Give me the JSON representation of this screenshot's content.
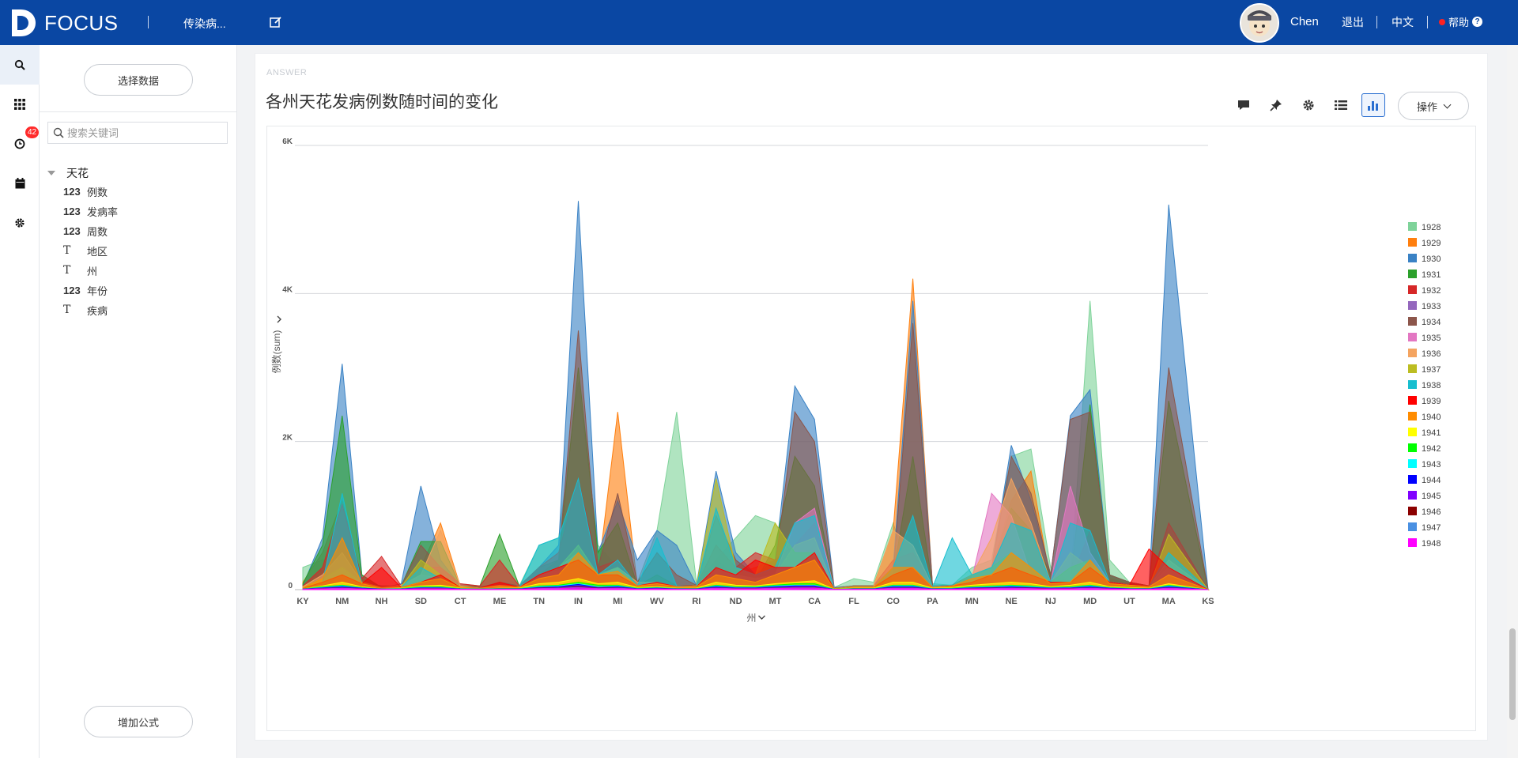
{
  "app": {
    "brand": "FOCUS",
    "nav_title": "传染病...",
    "user": "Chen",
    "logout": "退出",
    "lang": "中文",
    "help": "帮助"
  },
  "rail": {
    "history_badge": "42",
    "icons": [
      "search-icon",
      "grid-icon",
      "history-icon",
      "calendar-icon",
      "settings-icon"
    ]
  },
  "datapanel": {
    "select_data": "选择数据",
    "search_placeholder": "搜索关键词",
    "table": "天花",
    "fields": [
      {
        "type": "123",
        "name": "例数"
      },
      {
        "type": "123",
        "name": "发病率"
      },
      {
        "type": "123",
        "name": "周数"
      },
      {
        "type": "T",
        "name": "地区"
      },
      {
        "type": "T",
        "name": "州"
      },
      {
        "type": "123",
        "name": "年份"
      },
      {
        "type": "T",
        "name": "疾病"
      }
    ],
    "add_formula": "增加公式"
  },
  "card": {
    "tag": "ANSWER",
    "title": "各州天花发病例数随时间的变化",
    "operate": "操作"
  },
  "chart_data": {
    "type": "area",
    "title": "",
    "xlabel": "州",
    "ylabel": "例数(sum)",
    "ylim": [
      0,
      6000
    ],
    "yticks": [
      {
        "v": 0,
        "label": "0"
      },
      {
        "v": 2000,
        "label": "2K"
      },
      {
        "v": 4000,
        "label": "4K"
      },
      {
        "v": 6000,
        "label": "6K"
      }
    ],
    "categories": [
      "KY",
      "",
      "NM",
      "",
      "NH",
      "",
      "SD",
      "",
      "CT",
      "",
      "ME",
      "",
      "TN",
      "",
      "IN",
      "",
      "MI",
      "",
      "WV",
      "",
      "RI",
      "",
      "ND",
      "",
      "MT",
      "",
      "CA",
      "",
      "FL",
      "",
      "CO",
      "",
      "PA",
      "",
      "MN",
      "",
      "NE",
      "",
      "NJ",
      "",
      "MD",
      "",
      "UT",
      "",
      "MA",
      "",
      "KS"
    ],
    "grid": true,
    "legend_position": "right",
    "series": [
      {
        "name": "1928",
        "color": "#7fd39a",
        "values": [
          300,
          400,
          200,
          100,
          50,
          30,
          200,
          100,
          80,
          50,
          30,
          50,
          600,
          700,
          2800,
          600,
          300,
          100,
          800,
          2400,
          100,
          400,
          700,
          1000,
          900,
          400,
          600,
          30,
          150,
          100,
          900,
          50,
          80,
          60,
          300,
          400,
          1800,
          1900,
          300,
          100,
          3900,
          400,
          100,
          50,
          300
        ]
      },
      {
        "name": "1929",
        "color": "#ff7f0e",
        "values": [
          100,
          500,
          1200,
          150,
          30,
          50,
          300,
          900,
          50,
          20,
          30,
          50,
          200,
          300,
          400,
          200,
          2400,
          50,
          100,
          50,
          60,
          400,
          200,
          300,
          400,
          350,
          500,
          20,
          50,
          50,
          800,
          4200,
          50,
          60,
          200,
          300,
          1200,
          1600,
          100,
          50,
          400,
          150,
          80,
          50,
          700
        ]
      },
      {
        "name": "1930",
        "color": "#3a82c5",
        "values": [
          50,
          700,
          3050,
          200,
          20,
          80,
          1400,
          400,
          50,
          20,
          30,
          40,
          300,
          600,
          5250,
          500,
          1200,
          400,
          800,
          600,
          60,
          1600,
          500,
          200,
          400,
          2750,
          2300,
          30,
          50,
          50,
          300,
          3900,
          50,
          60,
          200,
          300,
          1950,
          1200,
          200,
          2350,
          2700,
          200,
          100,
          50,
          5200
        ]
      },
      {
        "name": "1931",
        "color": "#2ca02c",
        "values": [
          80,
          600,
          2350,
          200,
          30,
          50,
          650,
          650,
          50,
          50,
          750,
          50,
          200,
          400,
          3000,
          500,
          900,
          50,
          200,
          50,
          60,
          200,
          300,
          100,
          600,
          1800,
          1400,
          20,
          50,
          50,
          200,
          1800,
          50,
          60,
          100,
          300,
          1100,
          800,
          200,
          100,
          2500,
          200,
          100,
          50,
          2550
        ]
      },
      {
        "name": "1932",
        "color": "#d62728",
        "values": [
          50,
          300,
          1150,
          150,
          450,
          50,
          300,
          300,
          80,
          50,
          400,
          50,
          300,
          500,
          1500,
          300,
          400,
          50,
          100,
          50,
          60,
          600,
          300,
          500,
          400,
          600,
          900,
          20,
          50,
          50,
          400,
          500,
          50,
          60,
          200,
          300,
          400,
          300,
          100,
          100,
          800,
          100,
          80,
          50,
          900
        ]
      },
      {
        "name": "1934",
        "color": "#8c564b",
        "values": [
          40,
          200,
          400,
          100,
          50,
          50,
          600,
          300,
          50,
          30,
          100,
          50,
          300,
          400,
          3500,
          300,
          1300,
          100,
          500,
          200,
          60,
          1000,
          400,
          200,
          300,
          2400,
          2000,
          20,
          50,
          50,
          200,
          3600,
          50,
          60,
          200,
          300,
          1800,
          1300,
          200,
          2300,
          2400,
          200,
          100,
          50,
          3000
        ]
      },
      {
        "name": "1935",
        "color": "#e377c2",
        "values": [
          30,
          150,
          300,
          100,
          30,
          40,
          200,
          150,
          40,
          20,
          50,
          40,
          200,
          250,
          400,
          200,
          300,
          50,
          100,
          40,
          50,
          300,
          200,
          150,
          200,
          900,
          1100,
          15,
          40,
          40,
          100,
          300,
          40,
          50,
          150,
          1300,
          1000,
          200,
          100,
          1400,
          500,
          100,
          60,
          40,
          300
        ]
      },
      {
        "name": "1936",
        "color": "#f4a460",
        "values": [
          40,
          200,
          500,
          100,
          30,
          60,
          200,
          800,
          50,
          20,
          60,
          40,
          150,
          300,
          500,
          200,
          300,
          100,
          100,
          40,
          50,
          300,
          200,
          150,
          200,
          600,
          700,
          15,
          40,
          40,
          800,
          600,
          40,
          50,
          200,
          700,
          1500,
          900,
          100,
          500,
          300,
          100,
          60,
          40,
          400
        ]
      },
      {
        "name": "1937",
        "color": "#bcbd22",
        "values": [
          30,
          150,
          300,
          100,
          30,
          40,
          400,
          200,
          40,
          20,
          50,
          40,
          200,
          300,
          600,
          200,
          300,
          50,
          100,
          40,
          50,
          1500,
          300,
          200,
          900,
          500,
          500,
          15,
          40,
          40,
          200,
          300,
          40,
          50,
          200,
          300,
          500,
          300,
          100,
          300,
          400,
          100,
          60,
          40,
          750
        ]
      },
      {
        "name": "1938",
        "color": "#17becf",
        "values": [
          20,
          100,
          1300,
          80,
          20,
          30,
          300,
          150,
          30,
          20,
          40,
          30,
          600,
          700,
          1500,
          200,
          400,
          50,
          700,
          50,
          40,
          1100,
          300,
          200,
          300,
          900,
          1000,
          10,
          30,
          30,
          300,
          1000,
          30,
          700,
          200,
          300,
          900,
          800,
          100,
          900,
          800,
          100,
          60,
          40,
          500
        ]
      },
      {
        "name": "1939",
        "color": "#ff0000",
        "values": [
          20,
          100,
          200,
          80,
          300,
          30,
          100,
          200,
          30,
          20,
          100,
          30,
          200,
          300,
          400,
          200,
          200,
          50,
          100,
          40,
          40,
          300,
          200,
          400,
          300,
          300,
          500,
          10,
          30,
          30,
          200,
          300,
          30,
          50,
          100,
          200,
          300,
          200,
          100,
          100,
          300,
          100,
          60,
          550,
          300
        ]
      },
      {
        "name": "1940",
        "color": "#ff8c00",
        "values": [
          20,
          150,
          700,
          80,
          20,
          30,
          100,
          150,
          30,
          20,
          50,
          30,
          150,
          200,
          500,
          200,
          250,
          50,
          80,
          40,
          40,
          200,
          150,
          100,
          200,
          300,
          400,
          10,
          30,
          30,
          300,
          300,
          30,
          50,
          150,
          200,
          500,
          300,
          80,
          100,
          400,
          80,
          60,
          40,
          200
        ]
      },
      {
        "name": "1941",
        "color": "#ffff00",
        "values": [
          10,
          50,
          100,
          40,
          10,
          20,
          50,
          60,
          20,
          10,
          20,
          20,
          80,
          100,
          150,
          80,
          100,
          30,
          40,
          20,
          20,
          100,
          60,
          50,
          80,
          100,
          120,
          5,
          20,
          20,
          100,
          100,
          20,
          30,
          60,
          80,
          100,
          80,
          40,
          60,
          100,
          40,
          30,
          20,
          80
        ]
      },
      {
        "name": "1942",
        "color": "#00ff00",
        "values": [
          10,
          40,
          60,
          30,
          10,
          15,
          40,
          40,
          15,
          10,
          15,
          15,
          50,
          60,
          100,
          60,
          60,
          20,
          30,
          15,
          15,
          60,
          40,
          40,
          60,
          80,
          80,
          5,
          15,
          15,
          60,
          60,
          15,
          20,
          40,
          50,
          60,
          50,
          30,
          40,
          60,
          30,
          20,
          15,
          60
        ]
      },
      {
        "name": "1943",
        "color": "#00ffff",
        "values": [
          10,
          30,
          50,
          25,
          10,
          12,
          30,
          30,
          12,
          8,
          12,
          12,
          40,
          50,
          80,
          40,
          50,
          15,
          25,
          12,
          12,
          50,
          30,
          30,
          50,
          60,
          60,
          4,
          12,
          12,
          50,
          50,
          12,
          15,
          30,
          40,
          50,
          40,
          25,
          30,
          50,
          25,
          15,
          12,
          50
        ]
      },
      {
        "name": "1944",
        "color": "#0000ff",
        "values": [
          8,
          25,
          40,
          20,
          8,
          10,
          25,
          25,
          10,
          6,
          10,
          10,
          30,
          40,
          70,
          30,
          40,
          12,
          20,
          10,
          10,
          40,
          25,
          25,
          40,
          50,
          50,
          3,
          10,
          10,
          40,
          40,
          10,
          12,
          25,
          30,
          40,
          30,
          20,
          25,
          40,
          20,
          12,
          10,
          40
        ]
      },
      {
        "name": "1945",
        "color": "#8000ff",
        "values": [
          6,
          20,
          30,
          15,
          6,
          8,
          20,
          20,
          8,
          5,
          8,
          8,
          25,
          30,
          50,
          25,
          30,
          10,
          15,
          8,
          8,
          30,
          20,
          20,
          30,
          40,
          40,
          3,
          8,
          8,
          30,
          30,
          8,
          10,
          20,
          25,
          30,
          25,
          15,
          20,
          30,
          15,
          10,
          8,
          30
        ]
      },
      {
        "name": "1946",
        "color": "#8b0000",
        "values": [
          5,
          15,
          25,
          12,
          5,
          6,
          15,
          15,
          6,
          4,
          6,
          6,
          20,
          25,
          40,
          20,
          25,
          8,
          12,
          6,
          6,
          25,
          15,
          15,
          25,
          30,
          30,
          2,
          6,
          6,
          25,
          25,
          6,
          8,
          15,
          20,
          25,
          20,
          12,
          15,
          25,
          12,
          8,
          6,
          25
        ]
      },
      {
        "name": "1947",
        "color": "#4a90e2",
        "values": [
          4,
          12,
          20,
          10,
          4,
          5,
          12,
          12,
          5,
          3,
          5,
          5,
          15,
          20,
          30,
          15,
          20,
          6,
          10,
          5,
          5,
          20,
          12,
          12,
          20,
          25,
          25,
          2,
          5,
          5,
          20,
          20,
          5,
          6,
          12,
          15,
          20,
          15,
          10,
          12,
          20,
          10,
          6,
          5,
          20
        ]
      },
      {
        "name": "1948",
        "color": "#ff00ff",
        "values": [
          3,
          10,
          15,
          8,
          3,
          4,
          10,
          10,
          4,
          2,
          4,
          4,
          12,
          15,
          25,
          12,
          15,
          5,
          8,
          4,
          4,
          15,
          10,
          10,
          15,
          20,
          20,
          1,
          4,
          4,
          15,
          15,
          4,
          5,
          10,
          12,
          15,
          12,
          8,
          10,
          15,
          8,
          5,
          4,
          15
        ]
      }
    ],
    "legend_only": [
      {
        "name": "1933",
        "color": "#9467bd"
      }
    ]
  }
}
